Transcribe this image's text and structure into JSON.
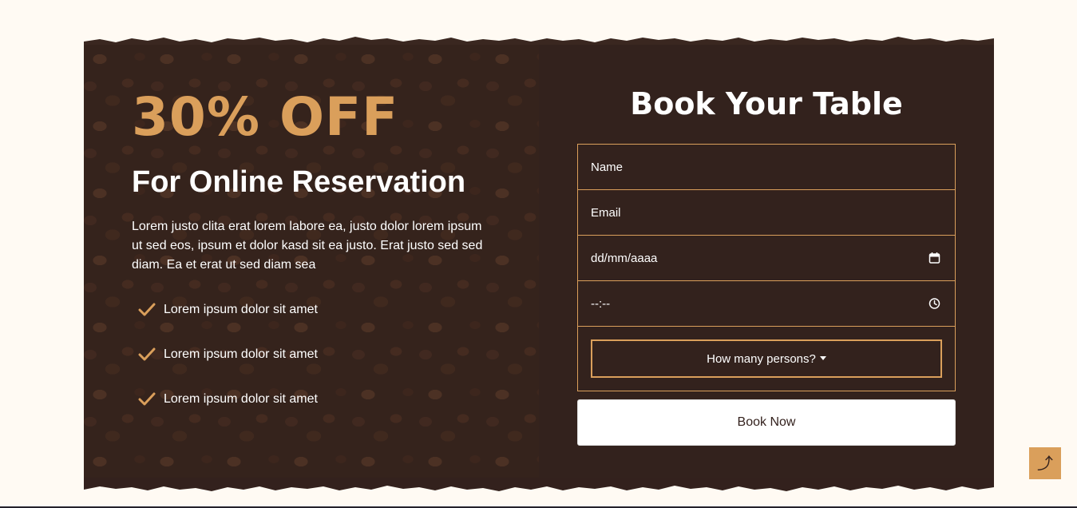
{
  "promo": {
    "headline": "30% OFF",
    "subheadline": "For Online Reservation",
    "text": "Lorem justo clita erat lorem labore ea, justo dolor lorem ipsum ut sed eos, ipsum et dolor kasd sit ea justo. Erat justo sed sed diam. Ea et erat ut sed diam sea",
    "features": [
      {
        "label": "Lorem ipsum dolor sit amet",
        "icon": "check-icon"
      },
      {
        "label": "Lorem ipsum dolor sit amet",
        "icon": "check-icon"
      },
      {
        "label": "Lorem ipsum dolor sit amet",
        "icon": "check-icon"
      }
    ]
  },
  "form": {
    "title": "Book Your Table",
    "name_placeholder": "Name",
    "email_placeholder": "Email",
    "date_placeholder": "dd/mm/aaaa",
    "time_placeholder": "--:--",
    "persons_label": "How many persons?",
    "submit_label": "Book Now",
    "icons": {
      "date": "calendar-icon",
      "time": "clock-icon",
      "persons": "caret-down-icon"
    }
  },
  "back_to_top": {
    "glyph": "⤴",
    "icon": "arrow-up-icon"
  },
  "colors": {
    "page_background": "#FFFAF3",
    "accent": "#DA9F5B",
    "dark_brown": "#33211D",
    "text_light": "#FFFFFF"
  }
}
